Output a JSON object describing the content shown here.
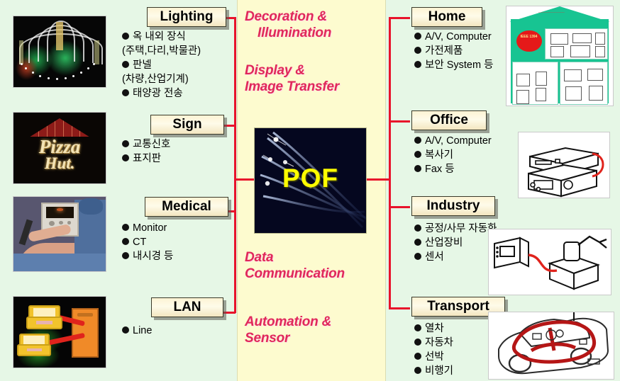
{
  "diagram": {
    "center_node": {
      "label": "POF",
      "image": "optical-fiber-strands-photo"
    },
    "center_categories": [
      {
        "id": "decoration",
        "line1": "Decoration &",
        "line2": "Illumination"
      },
      {
        "id": "display",
        "line1": "Display &",
        "line2": "Image Transfer"
      },
      {
        "id": "data",
        "line1": "Data",
        "line2": "Communication"
      },
      {
        "id": "automation",
        "line1": "Automation &",
        "line2": "Sensor"
      }
    ]
  },
  "left_branches": [
    {
      "id": "lighting",
      "title": "Lighting",
      "image": "night-illumination-fountain-photo",
      "items": [
        {
          "bullet": true,
          "text": "옥 내외 장식"
        },
        {
          "bullet": false,
          "text": "(주택,다리,박물관)"
        },
        {
          "bullet": true,
          "text": "판넬"
        },
        {
          "bullet": false,
          "text": "(차량,산업기계)"
        },
        {
          "bullet": true,
          "text": "태양광 전송"
        }
      ]
    },
    {
      "id": "sign",
      "title": "Sign",
      "image": "pizza-hut-illuminated-sign-photo",
      "items": [
        {
          "bullet": true,
          "text": "교통신호"
        },
        {
          "bullet": true,
          "text": "표지판"
        }
      ]
    },
    {
      "id": "medical",
      "title": "Medical",
      "image": "surgeon-endoscope-monitor-photo",
      "items": [
        {
          "bullet": true,
          "text": "Monitor"
        },
        {
          "bullet": true,
          "text": "CT"
        },
        {
          "bullet": true,
          "text": "내시경 등"
        }
      ]
    },
    {
      "id": "lan",
      "title": "LAN",
      "image": "laptops-server-network-illustration",
      "items": [
        {
          "bullet": true,
          "text": "Line"
        }
      ]
    }
  ],
  "right_branches": [
    {
      "id": "home",
      "title": "Home",
      "image": "home-network-house-diagram",
      "image_label": "IEEE 1394",
      "items": [
        {
          "bullet": true,
          "text": "A/V, Computer"
        },
        {
          "bullet": true,
          "text": "가전제품"
        },
        {
          "bullet": true,
          "text": "보안 System 등"
        }
      ]
    },
    {
      "id": "office",
      "title": "Office",
      "image": "office-av-equipment-illustration",
      "items": [
        {
          "bullet": true,
          "text": "A/V, Computer"
        },
        {
          "bullet": true,
          "text": "복사기"
        },
        {
          "bullet": true,
          "text": "Fax 등"
        }
      ]
    },
    {
      "id": "industry",
      "title": "Industry",
      "image": "industrial-robot-controller-illustration",
      "items": [
        {
          "bullet": true,
          "text": "공정/사무 자동화"
        },
        {
          "bullet": true,
          "text": "산업장비"
        },
        {
          "bullet": true,
          "text": "센서"
        }
      ]
    },
    {
      "id": "transport",
      "title": "Transport",
      "image": "car-optical-bus-illustration",
      "items": [
        {
          "bullet": true,
          "text": "열차"
        },
        {
          "bullet": true,
          "text": "자동차"
        },
        {
          "bullet": true,
          "text": "선박"
        },
        {
          "bullet": true,
          "text": "비행기"
        }
      ]
    }
  ],
  "colors": {
    "background": "#e6f7e6",
    "center_panel": "#fdfbcf",
    "category_text": "#e0285a",
    "connector": "#e8132b",
    "pof_text": "#ffff00",
    "pof_background": "#05071f"
  }
}
